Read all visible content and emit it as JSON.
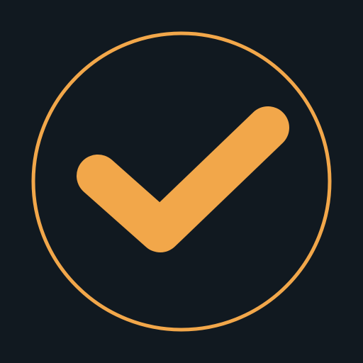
{
  "icon": {
    "name": "checkmark-circle-icon",
    "background_color": "#111920",
    "accent_color": "#F2A74A"
  }
}
